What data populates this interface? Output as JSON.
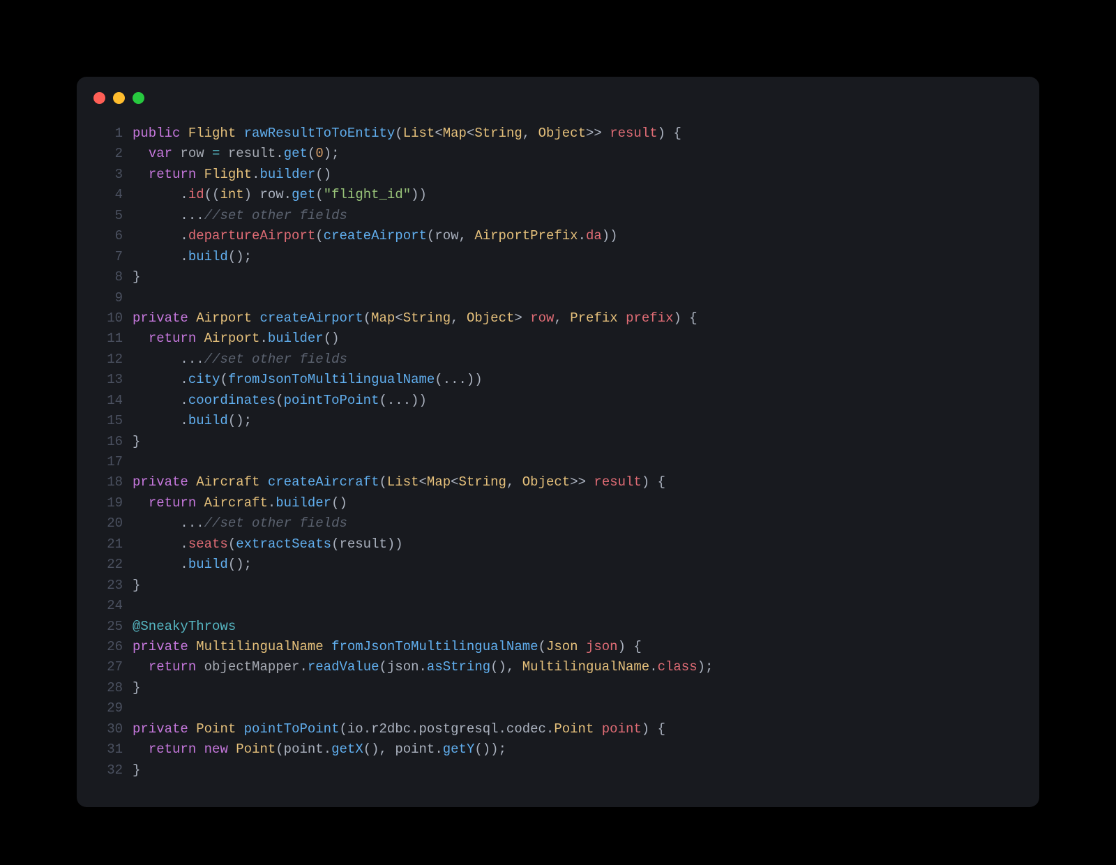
{
  "window": {
    "dots": [
      "red",
      "yellow",
      "green"
    ]
  },
  "code": {
    "lines": [
      {
        "n": 1,
        "tokens": [
          {
            "c": "kw",
            "t": "public"
          },
          {
            "t": " "
          },
          {
            "c": "type",
            "t": "Flight"
          },
          {
            "t": " "
          },
          {
            "c": "fn",
            "t": "rawResultToToEntity"
          },
          {
            "c": "punc",
            "t": "("
          },
          {
            "c": "type",
            "t": "List"
          },
          {
            "c": "punc",
            "t": "<"
          },
          {
            "c": "type",
            "t": "Map"
          },
          {
            "c": "punc",
            "t": "<"
          },
          {
            "c": "type",
            "t": "String"
          },
          {
            "c": "punc",
            "t": ", "
          },
          {
            "c": "type",
            "t": "Object"
          },
          {
            "c": "punc",
            "t": ">> "
          },
          {
            "c": "param",
            "t": "result"
          },
          {
            "c": "punc",
            "t": ") {"
          }
        ]
      },
      {
        "n": 2,
        "tokens": [
          {
            "t": "  "
          },
          {
            "c": "kw",
            "t": "var"
          },
          {
            "t": " row "
          },
          {
            "c": "op",
            "t": "="
          },
          {
            "t": " result"
          },
          {
            "c": "punc",
            "t": "."
          },
          {
            "c": "fn",
            "t": "get"
          },
          {
            "c": "punc",
            "t": "("
          },
          {
            "c": "num",
            "t": "0"
          },
          {
            "c": "punc",
            "t": ");"
          }
        ]
      },
      {
        "n": 3,
        "tokens": [
          {
            "t": "  "
          },
          {
            "c": "kw",
            "t": "return"
          },
          {
            "t": " "
          },
          {
            "c": "type",
            "t": "Flight"
          },
          {
            "c": "punc",
            "t": "."
          },
          {
            "c": "fn",
            "t": "builder"
          },
          {
            "c": "punc",
            "t": "()"
          }
        ]
      },
      {
        "n": 4,
        "tokens": [
          {
            "t": "      "
          },
          {
            "c": "punc",
            "t": "."
          },
          {
            "c": "prop",
            "t": "id"
          },
          {
            "c": "punc",
            "t": "(("
          },
          {
            "c": "type",
            "t": "int"
          },
          {
            "c": "punc",
            "t": ") row."
          },
          {
            "c": "fn",
            "t": "get"
          },
          {
            "c": "punc",
            "t": "("
          },
          {
            "c": "str",
            "t": "\"flight_id\""
          },
          {
            "c": "punc",
            "t": "))"
          }
        ]
      },
      {
        "n": 5,
        "tokens": [
          {
            "t": "      "
          },
          {
            "c": "punc",
            "t": "..."
          },
          {
            "c": "comment",
            "t": "//set other fields"
          }
        ]
      },
      {
        "n": 6,
        "tokens": [
          {
            "t": "      "
          },
          {
            "c": "punc",
            "t": "."
          },
          {
            "c": "prop",
            "t": "departureAirport"
          },
          {
            "c": "punc",
            "t": "("
          },
          {
            "c": "fn",
            "t": "createAirport"
          },
          {
            "c": "punc",
            "t": "(row, "
          },
          {
            "c": "type",
            "t": "AirportPrefix"
          },
          {
            "c": "punc",
            "t": "."
          },
          {
            "c": "prop",
            "t": "da"
          },
          {
            "c": "punc",
            "t": "))"
          }
        ]
      },
      {
        "n": 7,
        "tokens": [
          {
            "t": "      "
          },
          {
            "c": "punc",
            "t": "."
          },
          {
            "c": "fn",
            "t": "build"
          },
          {
            "c": "punc",
            "t": "();"
          }
        ]
      },
      {
        "n": 8,
        "tokens": [
          {
            "c": "punc",
            "t": "}"
          }
        ]
      },
      {
        "n": 9,
        "tokens": []
      },
      {
        "n": 10,
        "tokens": [
          {
            "c": "kw",
            "t": "private"
          },
          {
            "t": " "
          },
          {
            "c": "type",
            "t": "Airport"
          },
          {
            "t": " "
          },
          {
            "c": "fn",
            "t": "createAirport"
          },
          {
            "c": "punc",
            "t": "("
          },
          {
            "c": "type",
            "t": "Map"
          },
          {
            "c": "punc",
            "t": "<"
          },
          {
            "c": "type",
            "t": "String"
          },
          {
            "c": "punc",
            "t": ", "
          },
          {
            "c": "type",
            "t": "Object"
          },
          {
            "c": "punc",
            "t": "> "
          },
          {
            "c": "param",
            "t": "row"
          },
          {
            "c": "punc",
            "t": ", "
          },
          {
            "c": "type",
            "t": "Prefix"
          },
          {
            "t": " "
          },
          {
            "c": "param",
            "t": "prefix"
          },
          {
            "c": "punc",
            "t": ") {"
          }
        ]
      },
      {
        "n": 11,
        "tokens": [
          {
            "t": "  "
          },
          {
            "c": "kw",
            "t": "return"
          },
          {
            "t": " "
          },
          {
            "c": "type",
            "t": "Airport"
          },
          {
            "c": "punc",
            "t": "."
          },
          {
            "c": "fn",
            "t": "builder"
          },
          {
            "c": "punc",
            "t": "()"
          }
        ]
      },
      {
        "n": 12,
        "tokens": [
          {
            "t": "      "
          },
          {
            "c": "punc",
            "t": "..."
          },
          {
            "c": "comment",
            "t": "//set other fields"
          }
        ]
      },
      {
        "n": 13,
        "tokens": [
          {
            "t": "      "
          },
          {
            "c": "punc",
            "t": "."
          },
          {
            "c": "fn",
            "t": "city"
          },
          {
            "c": "punc",
            "t": "("
          },
          {
            "c": "fn",
            "t": "fromJsonToMultilingualName"
          },
          {
            "c": "punc",
            "t": "(...))"
          }
        ]
      },
      {
        "n": 14,
        "tokens": [
          {
            "t": "      "
          },
          {
            "c": "punc",
            "t": "."
          },
          {
            "c": "fn",
            "t": "coordinates"
          },
          {
            "c": "punc",
            "t": "("
          },
          {
            "c": "fn",
            "t": "pointToPoint"
          },
          {
            "c": "punc",
            "t": "(...))"
          }
        ]
      },
      {
        "n": 15,
        "tokens": [
          {
            "t": "      "
          },
          {
            "c": "punc",
            "t": "."
          },
          {
            "c": "fn",
            "t": "build"
          },
          {
            "c": "punc",
            "t": "();"
          }
        ]
      },
      {
        "n": 16,
        "tokens": [
          {
            "c": "punc",
            "t": "}"
          }
        ]
      },
      {
        "n": 17,
        "tokens": []
      },
      {
        "n": 18,
        "tokens": [
          {
            "c": "kw",
            "t": "private"
          },
          {
            "t": " "
          },
          {
            "c": "type",
            "t": "Aircraft"
          },
          {
            "t": " "
          },
          {
            "c": "fn",
            "t": "createAircraft"
          },
          {
            "c": "punc",
            "t": "("
          },
          {
            "c": "type",
            "t": "List"
          },
          {
            "c": "punc",
            "t": "<"
          },
          {
            "c": "type",
            "t": "Map"
          },
          {
            "c": "punc",
            "t": "<"
          },
          {
            "c": "type",
            "t": "String"
          },
          {
            "c": "punc",
            "t": ", "
          },
          {
            "c": "type",
            "t": "Object"
          },
          {
            "c": "punc",
            "t": ">> "
          },
          {
            "c": "param",
            "t": "result"
          },
          {
            "c": "punc",
            "t": ") {"
          }
        ]
      },
      {
        "n": 19,
        "tokens": [
          {
            "t": "  "
          },
          {
            "c": "kw",
            "t": "return"
          },
          {
            "t": " "
          },
          {
            "c": "type",
            "t": "Aircraft"
          },
          {
            "c": "punc",
            "t": "."
          },
          {
            "c": "fn",
            "t": "builder"
          },
          {
            "c": "punc",
            "t": "()"
          }
        ]
      },
      {
        "n": 20,
        "tokens": [
          {
            "t": "      "
          },
          {
            "c": "punc",
            "t": "..."
          },
          {
            "c": "comment",
            "t": "//set other fields"
          }
        ]
      },
      {
        "n": 21,
        "tokens": [
          {
            "t": "      "
          },
          {
            "c": "punc",
            "t": "."
          },
          {
            "c": "prop",
            "t": "seats"
          },
          {
            "c": "punc",
            "t": "("
          },
          {
            "c": "fn",
            "t": "extractSeats"
          },
          {
            "c": "punc",
            "t": "(result))"
          }
        ]
      },
      {
        "n": 22,
        "tokens": [
          {
            "t": "      "
          },
          {
            "c": "punc",
            "t": "."
          },
          {
            "c": "fn",
            "t": "build"
          },
          {
            "c": "punc",
            "t": "();"
          }
        ]
      },
      {
        "n": 23,
        "tokens": [
          {
            "c": "punc",
            "t": "}"
          }
        ]
      },
      {
        "n": 24,
        "tokens": []
      },
      {
        "n": 25,
        "tokens": [
          {
            "c": "annotation",
            "t": "@SneakyThrows"
          }
        ]
      },
      {
        "n": 26,
        "tokens": [
          {
            "c": "kw",
            "t": "private"
          },
          {
            "t": " "
          },
          {
            "c": "type",
            "t": "MultilingualName"
          },
          {
            "t": " "
          },
          {
            "c": "fn",
            "t": "fromJsonToMultilingualName"
          },
          {
            "c": "punc",
            "t": "("
          },
          {
            "c": "type",
            "t": "Json"
          },
          {
            "t": " "
          },
          {
            "c": "param",
            "t": "json"
          },
          {
            "c": "punc",
            "t": ") {"
          }
        ]
      },
      {
        "n": 27,
        "tokens": [
          {
            "t": "  "
          },
          {
            "c": "kw",
            "t": "return"
          },
          {
            "t": " objectMapper"
          },
          {
            "c": "punc",
            "t": "."
          },
          {
            "c": "fn",
            "t": "readValue"
          },
          {
            "c": "punc",
            "t": "(json."
          },
          {
            "c": "fn",
            "t": "asString"
          },
          {
            "c": "punc",
            "t": "(), "
          },
          {
            "c": "type",
            "t": "MultilingualName"
          },
          {
            "c": "punc",
            "t": "."
          },
          {
            "c": "prop",
            "t": "class"
          },
          {
            "c": "punc",
            "t": ");"
          }
        ]
      },
      {
        "n": 28,
        "tokens": [
          {
            "c": "punc",
            "t": "}"
          }
        ]
      },
      {
        "n": 29,
        "tokens": []
      },
      {
        "n": 30,
        "tokens": [
          {
            "c": "kw",
            "t": "private"
          },
          {
            "t": " "
          },
          {
            "c": "type",
            "t": "Point"
          },
          {
            "t": " "
          },
          {
            "c": "fn",
            "t": "pointToPoint"
          },
          {
            "c": "punc",
            "t": "(io.r2dbc.postgresql.codec."
          },
          {
            "c": "type",
            "t": "Point"
          },
          {
            "t": " "
          },
          {
            "c": "param",
            "t": "point"
          },
          {
            "c": "punc",
            "t": ") {"
          }
        ]
      },
      {
        "n": 31,
        "tokens": [
          {
            "t": "  "
          },
          {
            "c": "kw",
            "t": "return"
          },
          {
            "t": " "
          },
          {
            "c": "kw",
            "t": "new"
          },
          {
            "t": " "
          },
          {
            "c": "type",
            "t": "Point"
          },
          {
            "c": "punc",
            "t": "(point."
          },
          {
            "c": "fn",
            "t": "getX"
          },
          {
            "c": "punc",
            "t": "(), point."
          },
          {
            "c": "fn",
            "t": "getY"
          },
          {
            "c": "punc",
            "t": "());"
          }
        ]
      },
      {
        "n": 32,
        "tokens": [
          {
            "c": "punc",
            "t": "}"
          }
        ]
      }
    ]
  }
}
